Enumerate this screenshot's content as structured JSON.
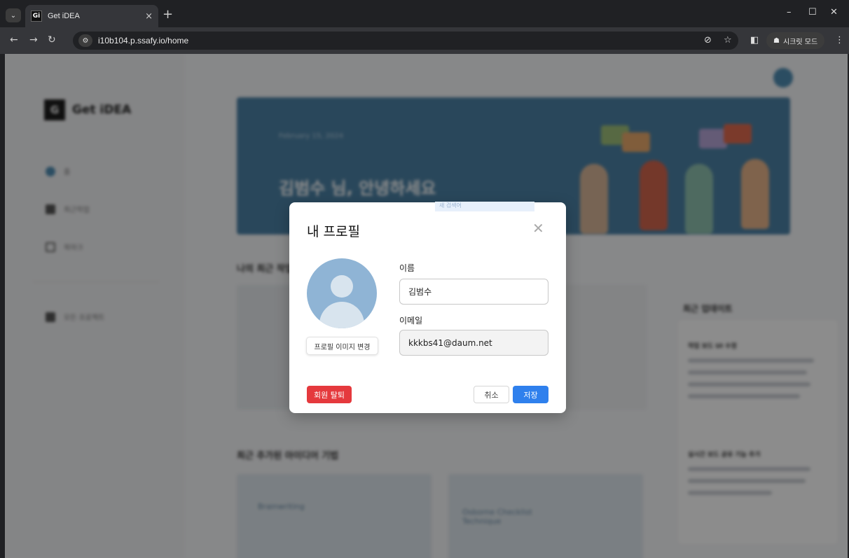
{
  "browser": {
    "tab_title": "Get iDEA",
    "favicon_text": "Gi",
    "url": "i10b104.p.ssafy.io/home",
    "incognito_label": "시크릿 모드"
  },
  "sidebar": {
    "logo_text": "Get iDEA",
    "items": [
      {
        "label": "홈"
      },
      {
        "label": "최근작업"
      },
      {
        "label": "북마크"
      },
      {
        "label": "모든 프로젝트"
      }
    ]
  },
  "main": {
    "banner_date": "February 15, 2024",
    "banner_greeting": "김범수 님, 안녕하세요",
    "recent_section_title": "나의 최근 작업",
    "popular_section_title": "최근 추가된 아이디어 기법",
    "updates_title": "최근 업데이트",
    "update_items": [
      {
        "title": "작업 보드 UI 수정"
      },
      {
        "title": "실시간 보드 공유 기능 추가"
      }
    ],
    "technique_cards": [
      {
        "label": "Brainwriting"
      },
      {
        "label": "Osborne Checklist Technique"
      }
    ]
  },
  "modal": {
    "title": "내 프로필",
    "change_image_button": "프로필 이미지 변경",
    "name_label": "이름",
    "name_value": "김범수",
    "email_label": "이메일",
    "email_value": "kkkbs41@daum.net",
    "withdraw_button": "회원 탈퇴",
    "cancel_button": "취소",
    "save_button": "저장",
    "hint_text": "새 검색어"
  },
  "colors": {
    "primary": "#2f80ed",
    "danger": "#e5393d",
    "banner": "#4c82a6"
  }
}
